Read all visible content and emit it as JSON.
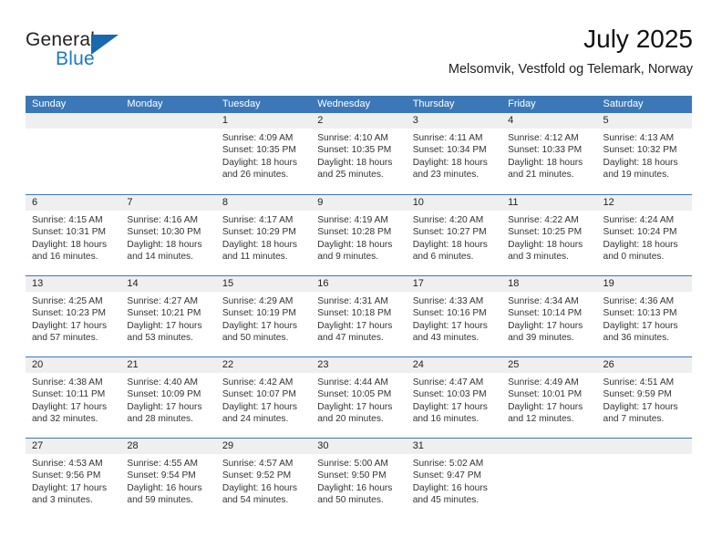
{
  "logo": {
    "word_top": "General",
    "word_bottom": "Blue",
    "triangle_color": "#1769b0",
    "blue_text_color": "#1a7ac4"
  },
  "header": {
    "title": "July 2025",
    "subtitle": "Melsomvik, Vestfold og Telemark, Norway"
  },
  "theme": {
    "header_blue": "#3c78b8",
    "day_band_gray": "#efefef",
    "text_color": "#333333"
  },
  "weekdays": [
    "Sunday",
    "Monday",
    "Tuesday",
    "Wednesday",
    "Thursday",
    "Friday",
    "Saturday"
  ],
  "weeks": [
    [
      {
        "day": "",
        "sunrise": "",
        "sunset": "",
        "daylight_line1": "",
        "daylight_line2": ""
      },
      {
        "day": "",
        "sunrise": "",
        "sunset": "",
        "daylight_line1": "",
        "daylight_line2": ""
      },
      {
        "day": "1",
        "sunrise": "Sunrise: 4:09 AM",
        "sunset": "Sunset: 10:35 PM",
        "daylight_line1": "Daylight: 18 hours",
        "daylight_line2": "and 26 minutes."
      },
      {
        "day": "2",
        "sunrise": "Sunrise: 4:10 AM",
        "sunset": "Sunset: 10:35 PM",
        "daylight_line1": "Daylight: 18 hours",
        "daylight_line2": "and 25 minutes."
      },
      {
        "day": "3",
        "sunrise": "Sunrise: 4:11 AM",
        "sunset": "Sunset: 10:34 PM",
        "daylight_line1": "Daylight: 18 hours",
        "daylight_line2": "and 23 minutes."
      },
      {
        "day": "4",
        "sunrise": "Sunrise: 4:12 AM",
        "sunset": "Sunset: 10:33 PM",
        "daylight_line1": "Daylight: 18 hours",
        "daylight_line2": "and 21 minutes."
      },
      {
        "day": "5",
        "sunrise": "Sunrise: 4:13 AM",
        "sunset": "Sunset: 10:32 PM",
        "daylight_line1": "Daylight: 18 hours",
        "daylight_line2": "and 19 minutes."
      }
    ],
    [
      {
        "day": "6",
        "sunrise": "Sunrise: 4:15 AM",
        "sunset": "Sunset: 10:31 PM",
        "daylight_line1": "Daylight: 18 hours",
        "daylight_line2": "and 16 minutes."
      },
      {
        "day": "7",
        "sunrise": "Sunrise: 4:16 AM",
        "sunset": "Sunset: 10:30 PM",
        "daylight_line1": "Daylight: 18 hours",
        "daylight_line2": "and 14 minutes."
      },
      {
        "day": "8",
        "sunrise": "Sunrise: 4:17 AM",
        "sunset": "Sunset: 10:29 PM",
        "daylight_line1": "Daylight: 18 hours",
        "daylight_line2": "and 11 minutes."
      },
      {
        "day": "9",
        "sunrise": "Sunrise: 4:19 AM",
        "sunset": "Sunset: 10:28 PM",
        "daylight_line1": "Daylight: 18 hours",
        "daylight_line2": "and 9 minutes."
      },
      {
        "day": "10",
        "sunrise": "Sunrise: 4:20 AM",
        "sunset": "Sunset: 10:27 PM",
        "daylight_line1": "Daylight: 18 hours",
        "daylight_line2": "and 6 minutes."
      },
      {
        "day": "11",
        "sunrise": "Sunrise: 4:22 AM",
        "sunset": "Sunset: 10:25 PM",
        "daylight_line1": "Daylight: 18 hours",
        "daylight_line2": "and 3 minutes."
      },
      {
        "day": "12",
        "sunrise": "Sunrise: 4:24 AM",
        "sunset": "Sunset: 10:24 PM",
        "daylight_line1": "Daylight: 18 hours",
        "daylight_line2": "and 0 minutes."
      }
    ],
    [
      {
        "day": "13",
        "sunrise": "Sunrise: 4:25 AM",
        "sunset": "Sunset: 10:23 PM",
        "daylight_line1": "Daylight: 17 hours",
        "daylight_line2": "and 57 minutes."
      },
      {
        "day": "14",
        "sunrise": "Sunrise: 4:27 AM",
        "sunset": "Sunset: 10:21 PM",
        "daylight_line1": "Daylight: 17 hours",
        "daylight_line2": "and 53 minutes."
      },
      {
        "day": "15",
        "sunrise": "Sunrise: 4:29 AM",
        "sunset": "Sunset: 10:19 PM",
        "daylight_line1": "Daylight: 17 hours",
        "daylight_line2": "and 50 minutes."
      },
      {
        "day": "16",
        "sunrise": "Sunrise: 4:31 AM",
        "sunset": "Sunset: 10:18 PM",
        "daylight_line1": "Daylight: 17 hours",
        "daylight_line2": "and 47 minutes."
      },
      {
        "day": "17",
        "sunrise": "Sunrise: 4:33 AM",
        "sunset": "Sunset: 10:16 PM",
        "daylight_line1": "Daylight: 17 hours",
        "daylight_line2": "and 43 minutes."
      },
      {
        "day": "18",
        "sunrise": "Sunrise: 4:34 AM",
        "sunset": "Sunset: 10:14 PM",
        "daylight_line1": "Daylight: 17 hours",
        "daylight_line2": "and 39 minutes."
      },
      {
        "day": "19",
        "sunrise": "Sunrise: 4:36 AM",
        "sunset": "Sunset: 10:13 PM",
        "daylight_line1": "Daylight: 17 hours",
        "daylight_line2": "and 36 minutes."
      }
    ],
    [
      {
        "day": "20",
        "sunrise": "Sunrise: 4:38 AM",
        "sunset": "Sunset: 10:11 PM",
        "daylight_line1": "Daylight: 17 hours",
        "daylight_line2": "and 32 minutes."
      },
      {
        "day": "21",
        "sunrise": "Sunrise: 4:40 AM",
        "sunset": "Sunset: 10:09 PM",
        "daylight_line1": "Daylight: 17 hours",
        "daylight_line2": "and 28 minutes."
      },
      {
        "day": "22",
        "sunrise": "Sunrise: 4:42 AM",
        "sunset": "Sunset: 10:07 PM",
        "daylight_line1": "Daylight: 17 hours",
        "daylight_line2": "and 24 minutes."
      },
      {
        "day": "23",
        "sunrise": "Sunrise: 4:44 AM",
        "sunset": "Sunset: 10:05 PM",
        "daylight_line1": "Daylight: 17 hours",
        "daylight_line2": "and 20 minutes."
      },
      {
        "day": "24",
        "sunrise": "Sunrise: 4:47 AM",
        "sunset": "Sunset: 10:03 PM",
        "daylight_line1": "Daylight: 17 hours",
        "daylight_line2": "and 16 minutes."
      },
      {
        "day": "25",
        "sunrise": "Sunrise: 4:49 AM",
        "sunset": "Sunset: 10:01 PM",
        "daylight_line1": "Daylight: 17 hours",
        "daylight_line2": "and 12 minutes."
      },
      {
        "day": "26",
        "sunrise": "Sunrise: 4:51 AM",
        "sunset": "Sunset: 9:59 PM",
        "daylight_line1": "Daylight: 17 hours",
        "daylight_line2": "and 7 minutes."
      }
    ],
    [
      {
        "day": "27",
        "sunrise": "Sunrise: 4:53 AM",
        "sunset": "Sunset: 9:56 PM",
        "daylight_line1": "Daylight: 17 hours",
        "daylight_line2": "and 3 minutes."
      },
      {
        "day": "28",
        "sunrise": "Sunrise: 4:55 AM",
        "sunset": "Sunset: 9:54 PM",
        "daylight_line1": "Daylight: 16 hours",
        "daylight_line2": "and 59 minutes."
      },
      {
        "day": "29",
        "sunrise": "Sunrise: 4:57 AM",
        "sunset": "Sunset: 9:52 PM",
        "daylight_line1": "Daylight: 16 hours",
        "daylight_line2": "and 54 minutes."
      },
      {
        "day": "30",
        "sunrise": "Sunrise: 5:00 AM",
        "sunset": "Sunset: 9:50 PM",
        "daylight_line1": "Daylight: 16 hours",
        "daylight_line2": "and 50 minutes."
      },
      {
        "day": "31",
        "sunrise": "Sunrise: 5:02 AM",
        "sunset": "Sunset: 9:47 PM",
        "daylight_line1": "Daylight: 16 hours",
        "daylight_line2": "and 45 minutes."
      },
      {
        "day": "",
        "sunrise": "",
        "sunset": "",
        "daylight_line1": "",
        "daylight_line2": ""
      },
      {
        "day": "",
        "sunrise": "",
        "sunset": "",
        "daylight_line1": "",
        "daylight_line2": ""
      }
    ]
  ]
}
